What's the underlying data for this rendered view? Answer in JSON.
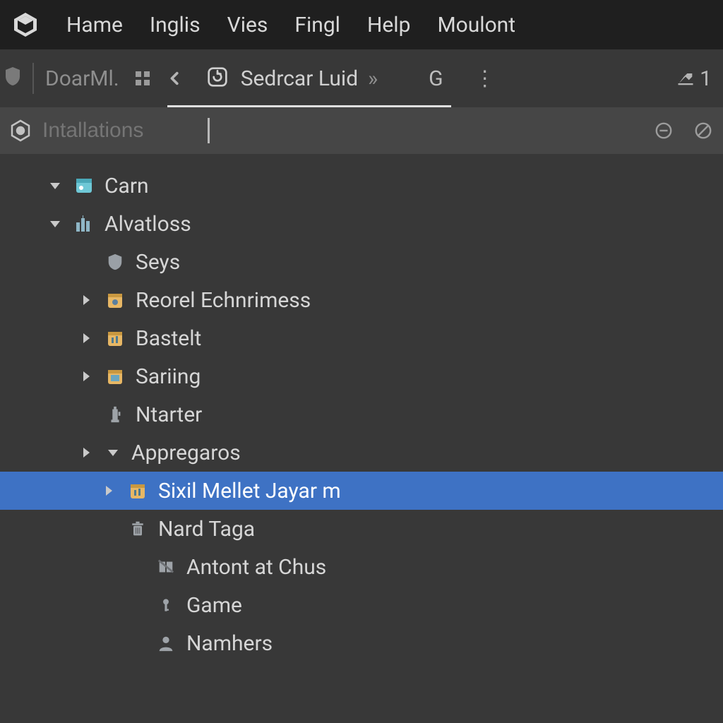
{
  "menubar": {
    "items": [
      "Hame",
      "Inglis",
      "Vies",
      "Fingl",
      "Help",
      "Moulont"
    ]
  },
  "tabbar": {
    "left_label": "DoarMl.",
    "tab_label": "Sedrcar Luid",
    "tab_chevrons": "»",
    "g_label": "G",
    "right_count": "1"
  },
  "searchbar": {
    "placeholder": "Intallations"
  },
  "tree": [
    {
      "depth": 0,
      "arrow": "down",
      "icon": "scene",
      "label": "Carn",
      "selected": false
    },
    {
      "depth": 0,
      "arrow": "down",
      "icon": "city",
      "label": "Alvatloss",
      "selected": false
    },
    {
      "depth": 1,
      "arrow": "none",
      "icon": "shield",
      "label": "Seys",
      "selected": false
    },
    {
      "depth": 1,
      "arrow": "right",
      "icon": "folder-a",
      "label": "Reorel Echnrimess",
      "selected": false
    },
    {
      "depth": 1,
      "arrow": "right",
      "icon": "folder-b",
      "label": "Bastelt",
      "selected": false
    },
    {
      "depth": 1,
      "arrow": "right",
      "icon": "folder-c",
      "label": "Sariing",
      "selected": false
    },
    {
      "depth": 1,
      "arrow": "none",
      "icon": "tower",
      "label": "Ntarter",
      "selected": false
    },
    {
      "depth": 1,
      "arrow": "right2",
      "icon": "none",
      "label": "Appregaros",
      "selected": false
    },
    {
      "depth": 2,
      "arrow": "right",
      "icon": "folder-b",
      "label": "Sixil Mellet Jayar m",
      "selected": true
    },
    {
      "depth": 2,
      "arrow": "none",
      "icon": "trash",
      "label": "Nard Taga",
      "selected": false
    },
    {
      "depth": 3,
      "arrow": "none",
      "icon": "book",
      "label": "Antont at Chus",
      "selected": false
    },
    {
      "depth": 3,
      "arrow": "none",
      "icon": "key",
      "label": "Game",
      "selected": false
    },
    {
      "depth": 3,
      "arrow": "none",
      "icon": "person",
      "label": "Namhers",
      "selected": false
    }
  ]
}
